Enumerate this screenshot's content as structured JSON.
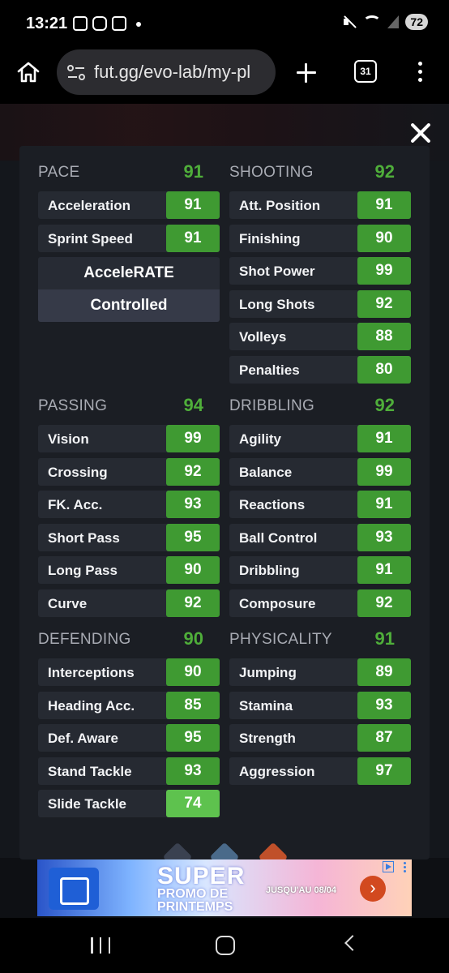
{
  "status_bar": {
    "time": "13:21",
    "battery": "72"
  },
  "browser": {
    "url": "fut.gg/evo-lab/my-pl",
    "tab_count": "31"
  },
  "stats": {
    "pace": {
      "title": "PACE",
      "value": "91",
      "items": [
        {
          "label": "Acceleration",
          "value": "91"
        },
        {
          "label": "Sprint Speed",
          "value": "91"
        }
      ],
      "playstyles": [
        "AcceleRATE",
        "Controlled"
      ]
    },
    "shooting": {
      "title": "SHOOTING",
      "value": "92",
      "items": [
        {
          "label": "Att. Position",
          "value": "91"
        },
        {
          "label": "Finishing",
          "value": "90"
        },
        {
          "label": "Shot Power",
          "value": "99"
        },
        {
          "label": "Long Shots",
          "value": "92"
        },
        {
          "label": "Volleys",
          "value": "88"
        },
        {
          "label": "Penalties",
          "value": "80"
        }
      ]
    },
    "passing": {
      "title": "PASSING",
      "value": "94",
      "items": [
        {
          "label": "Vision",
          "value": "99"
        },
        {
          "label": "Crossing",
          "value": "92"
        },
        {
          "label": "FK. Acc.",
          "value": "93"
        },
        {
          "label": "Short Pass",
          "value": "95"
        },
        {
          "label": "Long Pass",
          "value": "90"
        },
        {
          "label": "Curve",
          "value": "92"
        }
      ]
    },
    "dribbling": {
      "title": "DRIBBLING",
      "value": "92",
      "items": [
        {
          "label": "Agility",
          "value": "91"
        },
        {
          "label": "Balance",
          "value": "99"
        },
        {
          "label": "Reactions",
          "value": "91"
        },
        {
          "label": "Ball Control",
          "value": "93"
        },
        {
          "label": "Dribbling",
          "value": "91"
        },
        {
          "label": "Composure",
          "value": "92"
        }
      ]
    },
    "defending": {
      "title": "DEFENDING",
      "value": "90",
      "items": [
        {
          "label": "Interceptions",
          "value": "90"
        },
        {
          "label": "Heading Acc.",
          "value": "85"
        },
        {
          "label": "Def. Aware",
          "value": "95"
        },
        {
          "label": "Stand Tackle",
          "value": "93"
        },
        {
          "label": "Slide Tackle",
          "value": "74"
        }
      ]
    },
    "physicality": {
      "title": "PHYSICALITY",
      "value": "91",
      "items": [
        {
          "label": "Jumping",
          "value": "89"
        },
        {
          "label": "Stamina",
          "value": "93"
        },
        {
          "label": "Strength",
          "value": "87"
        },
        {
          "label": "Aggression",
          "value": "97"
        }
      ]
    }
  },
  "colors": {
    "stat_green": "#3f9a32",
    "stat_light_green": "#5ec24e",
    "heading_green": "#4fae3a"
  },
  "ad": {
    "title": "SUPER",
    "line1": "PROMO DE",
    "line2": "PRINTEMPS",
    "date": "JUSQU'AU 08/04",
    "arrow": "›"
  }
}
